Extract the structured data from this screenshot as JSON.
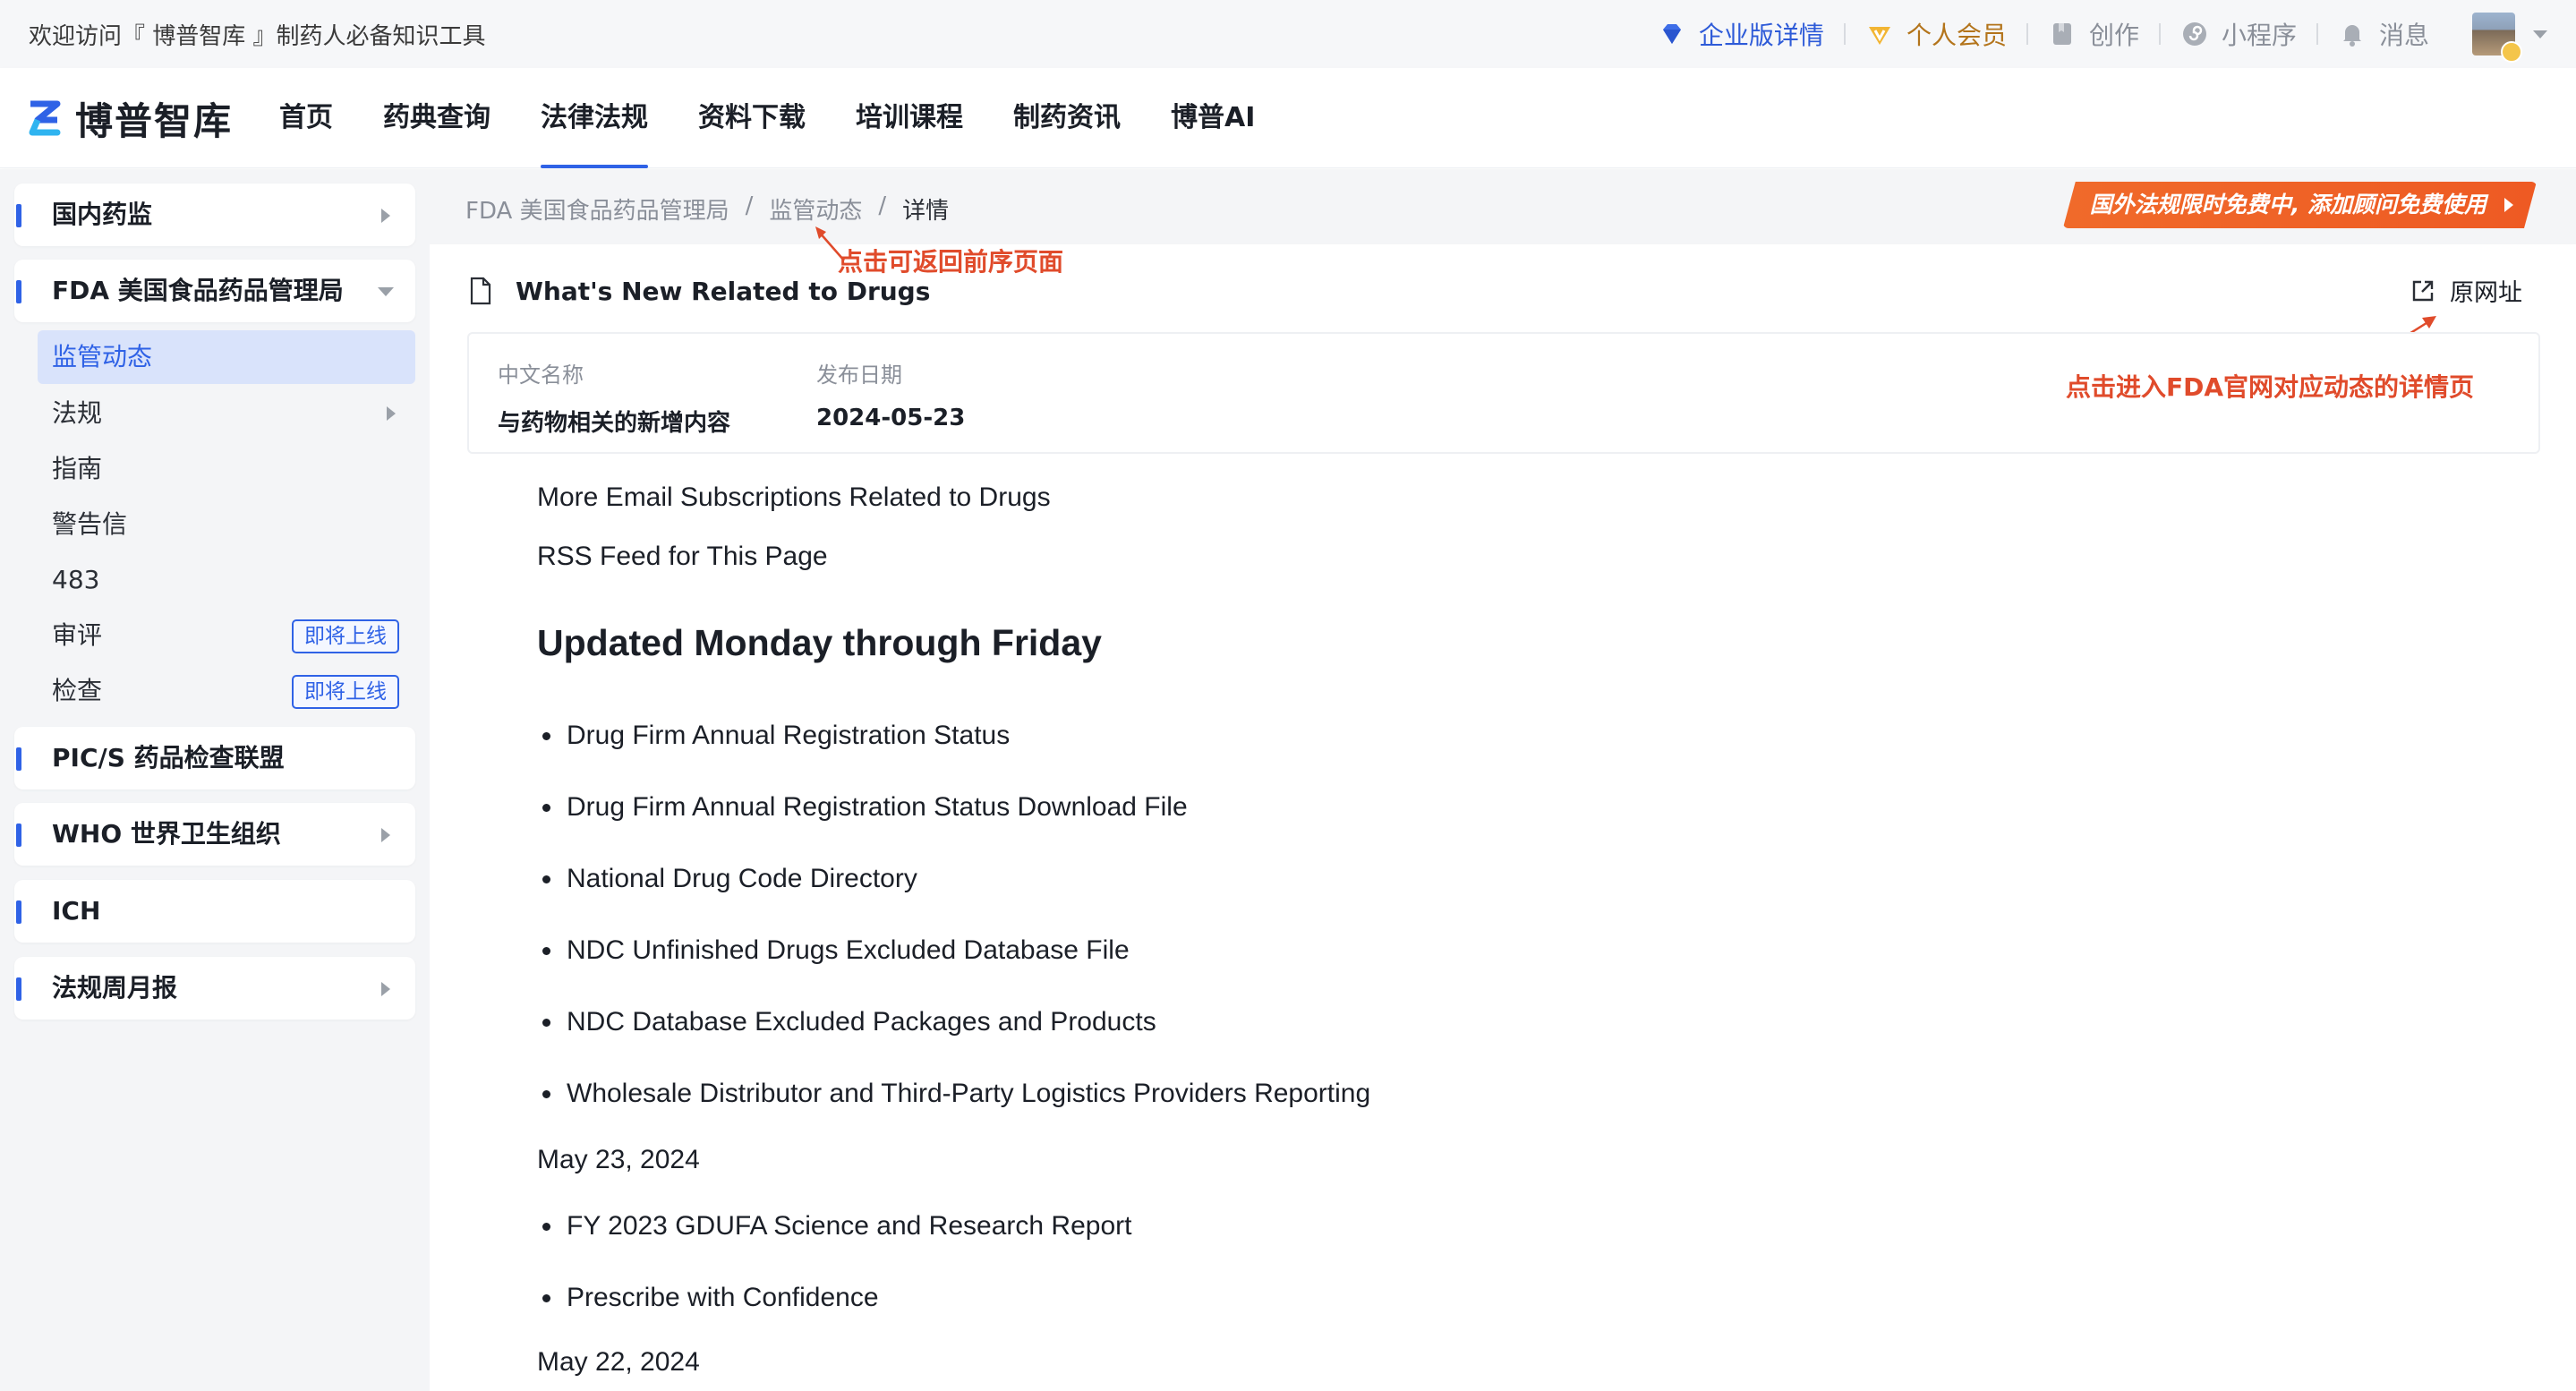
{
  "topbar": {
    "welcome": "欢迎访问『 博普智库 』制药人必备知识工具",
    "links": {
      "enterprise": "企业版详情",
      "vip": "个人会员",
      "create": "创作",
      "miniapp": "小程序",
      "messages": "消息"
    }
  },
  "header": {
    "logo_text": "博普智库",
    "nav": [
      "首页",
      "药典查询",
      "法律法规",
      "资料下载",
      "培训课程",
      "制药资讯",
      "博普AI"
    ],
    "active_nav": "法律法规"
  },
  "sidebar": {
    "sections": {
      "domestic": "国内药监",
      "fda": "FDA 美国食品药品管理局",
      "pics": "PIC/S 药品检查联盟",
      "who": "WHO 世界卫生组织",
      "ich": "ICH",
      "weekly": "法规周月报"
    },
    "fda_items": [
      "监管动态",
      "法规",
      "指南",
      "警告信",
      "483",
      "审评",
      "检查"
    ],
    "coming_soon": "即将上线"
  },
  "content": {
    "breadcrumb": [
      "FDA 美国食品药品管理局",
      "监管动态",
      "详情"
    ],
    "promo": "国外法规限时免费中, 添加顾问免费使用",
    "annotation_back": "点击可返回前序页面",
    "annotation_origin": "点击进入FDA官网对应动态的详情页",
    "doc_title": "What's New Related to Drugs",
    "origin_link": "原网址",
    "info": {
      "cn_name_label": "中文名称",
      "cn_name": "与药物相关的新增内容",
      "date_label": "发布日期",
      "date": "2024-05-23"
    },
    "article": {
      "line1": "More Email Subscriptions Related to Drugs",
      "line2": "RSS Feed for This Page",
      "heading": "Updated Monday through Friday",
      "list1": [
        "Drug Firm Annual Registration Status",
        "Drug Firm Annual Registration Status Download File",
        "National Drug Code Directory",
        "NDC Unfinished Drugs Excluded Database File",
        "NDC Database Excluded Packages and Products",
        "Wholesale Distributor and Third-Party Logistics Providers Reporting"
      ],
      "date1": "May 23, 2024",
      "list2": [
        "FY 2023 GDUFA Science and Research Report",
        "Prescribe with Confidence"
      ],
      "date2": "May 22, 2024"
    }
  },
  "colors": {
    "accent": "#2f62e6",
    "annotation": "#e04b2b",
    "promo": "#ee5a23",
    "vip": "#b3741b"
  }
}
